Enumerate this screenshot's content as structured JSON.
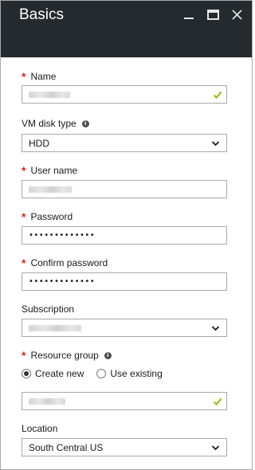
{
  "window": {
    "title": "Basics",
    "minimize_icon": "minimize-icon",
    "maximize_icon": "maximize-icon",
    "close_icon": "close-icon"
  },
  "form": {
    "name": {
      "label": "Name",
      "required": true,
      "value_obscured": true,
      "valid": true
    },
    "disk_type": {
      "label": "VM disk type",
      "value": "HDD",
      "options_visible": [
        "HDD"
      ]
    },
    "user_name": {
      "label": "User name",
      "required": true,
      "value_obscured": true
    },
    "password": {
      "label": "Password",
      "required": true,
      "value": "•••••••••••••"
    },
    "confirm_password": {
      "label": "Confirm password",
      "required": true,
      "value": "•••••••••••••"
    },
    "subscription": {
      "label": "Subscription",
      "value_obscured": true
    },
    "resource_group": {
      "label": "Resource group",
      "required": true,
      "options": [
        "Create new",
        "Use existing"
      ],
      "selected": "Create new",
      "value_obscured": true,
      "valid": true
    },
    "location": {
      "label": "Location",
      "value": "South Central US"
    }
  },
  "colors": {
    "titlebar_bg": "#252a2e",
    "required_asterisk": "#d8262a",
    "valid_check": "#7fba00",
    "field_border": "#a9a9a9"
  }
}
